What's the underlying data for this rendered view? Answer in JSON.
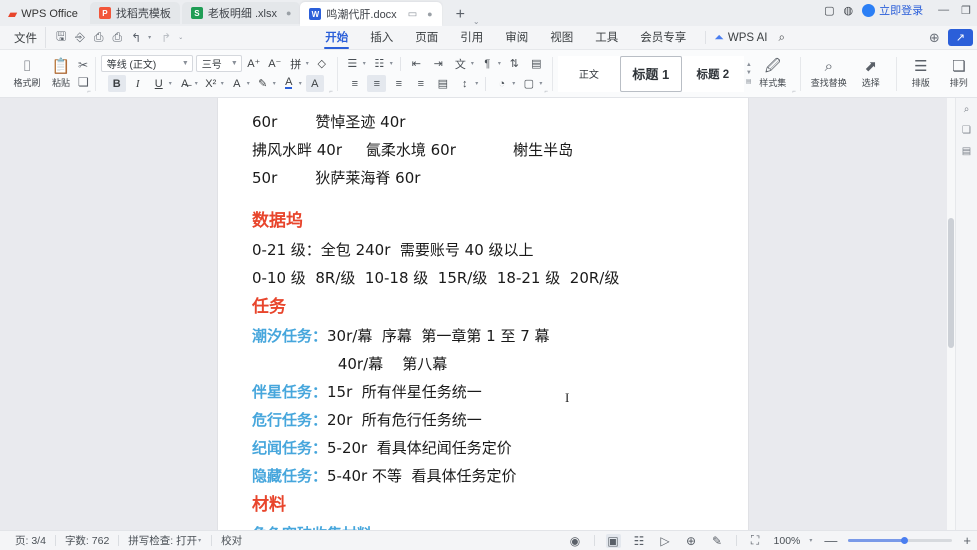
{
  "app": {
    "brand": "WPS Office",
    "login_label": "立即登录"
  },
  "tabs": [
    {
      "label": "找稻壳模板",
      "icon": "pdf-icon",
      "kind": "pdf",
      "active": false
    },
    {
      "label": "老板明细 .xlsx",
      "icon": "excel-icon",
      "kind": "xls",
      "active": false
    },
    {
      "label": "鸣潮代肝.docx",
      "icon": "word-icon",
      "kind": "doc",
      "active": true
    }
  ],
  "tabbar": {
    "new_tab": "+",
    "caret": "⌄"
  },
  "window": {
    "minimize": "—",
    "restore": "❐",
    "cloud": "☁",
    "screen": "▢"
  },
  "menu": {
    "file": "文件",
    "items": [
      {
        "label": "开始",
        "active": true
      },
      {
        "label": "插入",
        "active": false
      },
      {
        "label": "页面",
        "active": false
      },
      {
        "label": "引用",
        "active": false
      },
      {
        "label": "审阅",
        "active": false
      },
      {
        "label": "视图",
        "active": false
      },
      {
        "label": "工具",
        "active": false
      },
      {
        "label": "会员专享",
        "active": false
      }
    ],
    "wps_ai": "WPS AI",
    "search_icon": "search-icon"
  },
  "ribbon": {
    "format_painter": "格式刷",
    "paste": "粘贴",
    "font_name": "等线 (正文)",
    "font_size": "三号",
    "bold": "B",
    "italic": "I",
    "underline": "U",
    "styles": [
      {
        "label": "正文",
        "selected": false
      },
      {
        "label": "标题 1",
        "selected": true
      },
      {
        "label": "标题 2",
        "selected": false
      }
    ],
    "style_set": "样式集",
    "find_replace": "查找替换",
    "select": "选择",
    "typeset": "排版",
    "arrange": "排列"
  },
  "document": {
    "lines": [
      {
        "type": "text",
        "runs": [
          {
            "text": "60r        赞悼圣迹 40r",
            "color": "black"
          }
        ]
      },
      {
        "type": "text",
        "runs": [
          {
            "text": "拂风水畔 40r     氤柔水境 60r            榭生半岛",
            "color": "black"
          }
        ]
      },
      {
        "type": "text",
        "runs": [
          {
            "text": "50r        狄萨莱海脊 60r",
            "color": "black"
          }
        ]
      },
      {
        "type": "gap"
      },
      {
        "type": "heading",
        "runs": [
          {
            "text": "数据坞",
            "color": "red"
          }
        ]
      },
      {
        "type": "text",
        "runs": [
          {
            "text": "0-21 级：全包 240r  需要账号 40 级以上",
            "color": "black"
          }
        ]
      },
      {
        "type": "text",
        "runs": [
          {
            "text": "0-10 级  8R/级  10-18 级  15R/级  18-21 级  20R/级",
            "color": "black"
          }
        ]
      },
      {
        "type": "heading",
        "runs": [
          {
            "text": "任务",
            "color": "red"
          }
        ]
      },
      {
        "type": "text",
        "runs": [
          {
            "text": "潮汐任务：",
            "color": "blue"
          },
          {
            "text": "30r/幕  序幕  第一章第 1 至 7 幕",
            "color": "black"
          }
        ]
      },
      {
        "type": "text",
        "runs": [
          {
            "text": "                  40r/幕    第八幕",
            "color": "black"
          }
        ]
      },
      {
        "type": "text",
        "runs": [
          {
            "text": "伴星任务：",
            "color": "blue"
          },
          {
            "text": "15r  所有伴星任务统一",
            "color": "black"
          }
        ]
      },
      {
        "type": "text",
        "runs": [
          {
            "text": "危行任务：",
            "color": "blue"
          },
          {
            "text": "20r  所有危行任务统一",
            "color": "black"
          }
        ]
      },
      {
        "type": "text",
        "runs": [
          {
            "text": "纪闻任务：",
            "color": "blue"
          },
          {
            "text": "5-20r  看具体纪闻任务定价",
            "color": "black"
          }
        ]
      },
      {
        "type": "text",
        "runs": [
          {
            "text": "隐藏任务：",
            "color": "blue"
          },
          {
            "text": "5-40r 不等  看具体任务定价",
            "color": "black"
          }
        ]
      },
      {
        "type": "heading",
        "runs": [
          {
            "text": "材料",
            "color": "red"
          }
        ]
      },
      {
        "type": "text",
        "runs": [
          {
            "text": "角色突破收集材料",
            "color": "blue"
          }
        ]
      }
    ],
    "colors": {
      "heading_red": "#e8452c",
      "label_blue": "#46a6dc",
      "body_black": "#1a1a1a"
    }
  },
  "status": {
    "page": "页: 3/4",
    "words": "字数: 762",
    "spellcheck": "拼写检查: 打开",
    "proofread": "校对",
    "zoom": "100%",
    "zoom_out": "—",
    "zoom_in": "+"
  }
}
